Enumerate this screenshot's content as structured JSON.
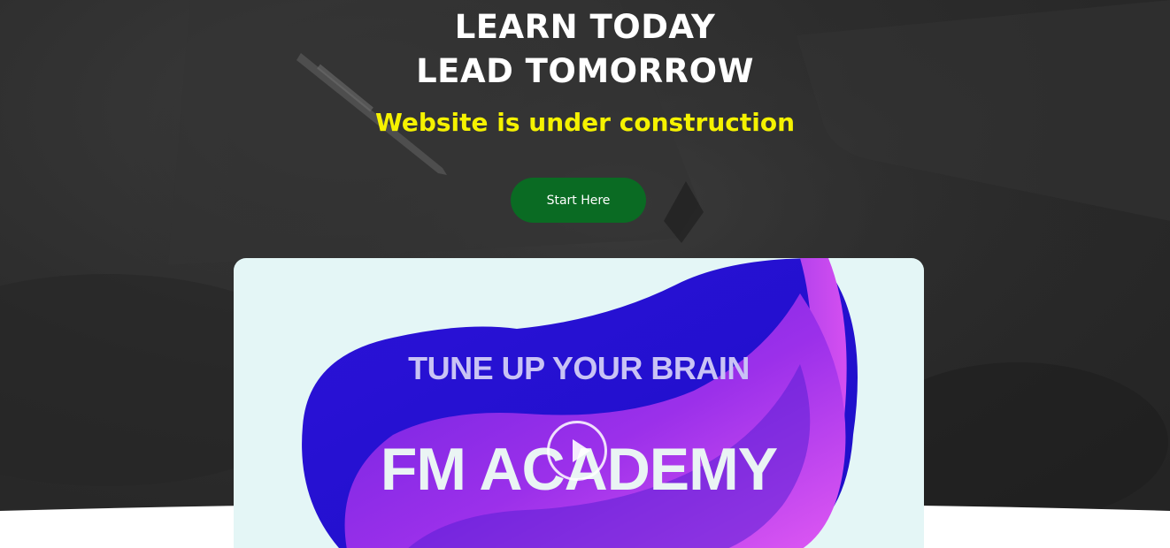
{
  "hero": {
    "headline_line1": "LEARN TODAY",
    "headline_line2": "LEAD TOMORROW",
    "subtitle": "Website is under construction",
    "cta_label": "Start Here"
  },
  "video": {
    "tagline": "TUNE UP YOUR BRAIN",
    "title": "FM ACADEMY",
    "play_icon": "play-icon"
  },
  "colors": {
    "hero_background": "#2c2c2c",
    "headline": "#ffffff",
    "subtitle": "#f5f200",
    "cta_background": "#0a6b23",
    "card_background": "#e4f6f6",
    "blob_blue": "#2410d2",
    "blob_purple": "#8a2be2",
    "blob_pink": "#e257f2"
  }
}
